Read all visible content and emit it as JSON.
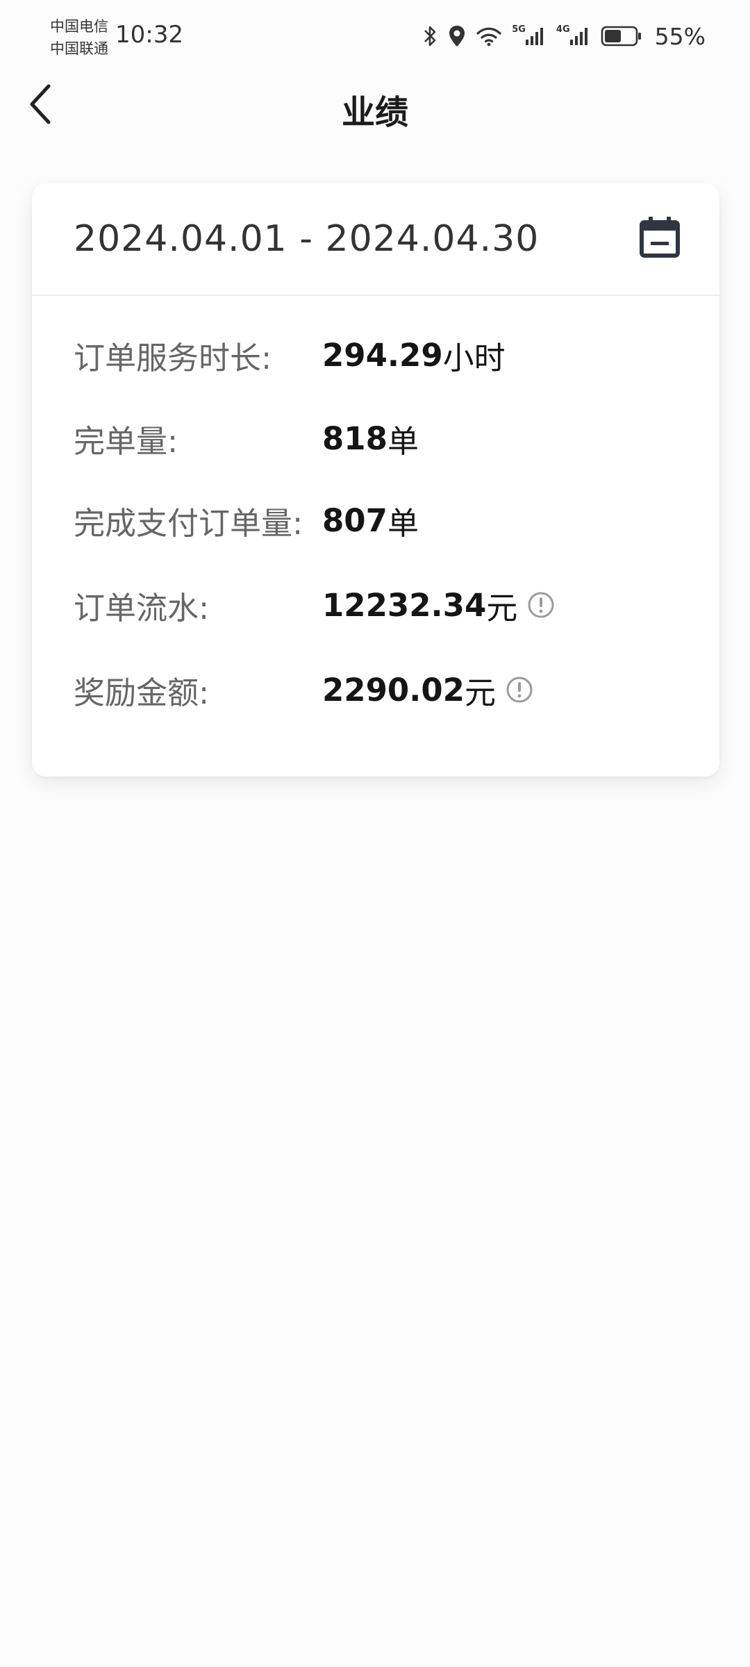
{
  "status_bar": {
    "carrier1": "中国电信",
    "carrier2": "中国联通",
    "time": "10:32",
    "signal1_label": "5G",
    "signal2_label": "4G",
    "battery_percent": "55%",
    "battery_level": 0.55,
    "icons": [
      "bluetooth-icon",
      "location-icon",
      "wifi-icon",
      "signal-icon",
      "battery-icon"
    ]
  },
  "header": {
    "title": "业绩",
    "back_icon": "chevron-left-icon"
  },
  "date_filter": {
    "range": "2024.04.01 - 2024.04.30",
    "icon": "calendar-icon"
  },
  "stats": [
    {
      "label": "订单服务时长:",
      "value": "294.29",
      "unit": "小时"
    },
    {
      "label": "完单量:",
      "value": "818",
      "unit": "单"
    },
    {
      "label": "完成支付订单量:",
      "value": "807",
      "unit": "单"
    },
    {
      "label": "订单流水:",
      "value": "12232.34",
      "unit": "元",
      "info_icon": "info-icon"
    },
    {
      "label": "奖励金额:",
      "value": "2290.02",
      "unit": "元",
      "info_icon": "info-icon"
    }
  ],
  "colors": {
    "background": "#fcfcfc",
    "card": "#ffffff",
    "label_text": "#666666",
    "value_text": "#151515",
    "icon_dark": "#333a44",
    "info_icon": "#9a9a9a"
  }
}
